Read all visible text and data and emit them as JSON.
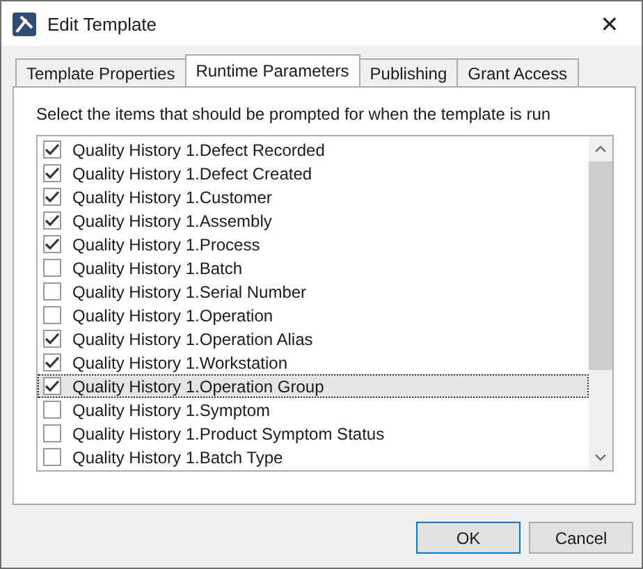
{
  "window": {
    "title": "Edit Template",
    "close": "✕"
  },
  "tabs": [
    {
      "label": "Template Properties",
      "selected": false
    },
    {
      "label": "Runtime Parameters",
      "selected": true
    },
    {
      "label": "Publishing",
      "selected": false
    },
    {
      "label": "Grant Access",
      "selected": false
    }
  ],
  "instruction": "Select the items that should be prompted for when the template is run",
  "items": [
    {
      "label": "Quality History 1.Defect Recorded",
      "checked": true,
      "selected": false
    },
    {
      "label": "Quality History 1.Defect Created",
      "checked": true,
      "selected": false
    },
    {
      "label": "Quality History 1.Customer",
      "checked": true,
      "selected": false
    },
    {
      "label": "Quality History 1.Assembly",
      "checked": true,
      "selected": false
    },
    {
      "label": "Quality History 1.Process",
      "checked": true,
      "selected": false
    },
    {
      "label": "Quality History 1.Batch",
      "checked": false,
      "selected": false
    },
    {
      "label": "Quality History 1.Serial Number",
      "checked": false,
      "selected": false
    },
    {
      "label": "Quality History 1.Operation",
      "checked": false,
      "selected": false
    },
    {
      "label": "Quality History 1.Operation Alias",
      "checked": true,
      "selected": false
    },
    {
      "label": "Quality History 1.Workstation",
      "checked": true,
      "selected": false
    },
    {
      "label": "Quality History 1.Operation Group",
      "checked": true,
      "selected": true
    },
    {
      "label": "Quality History 1.Symptom",
      "checked": false,
      "selected": false
    },
    {
      "label": "Quality History 1.Product Symptom Status",
      "checked": false,
      "selected": false
    },
    {
      "label": "Quality History 1.Batch Type",
      "checked": false,
      "selected": false
    }
  ],
  "buttons": [
    {
      "label": "OK",
      "default": true
    },
    {
      "label": "Cancel",
      "default": false
    }
  ]
}
